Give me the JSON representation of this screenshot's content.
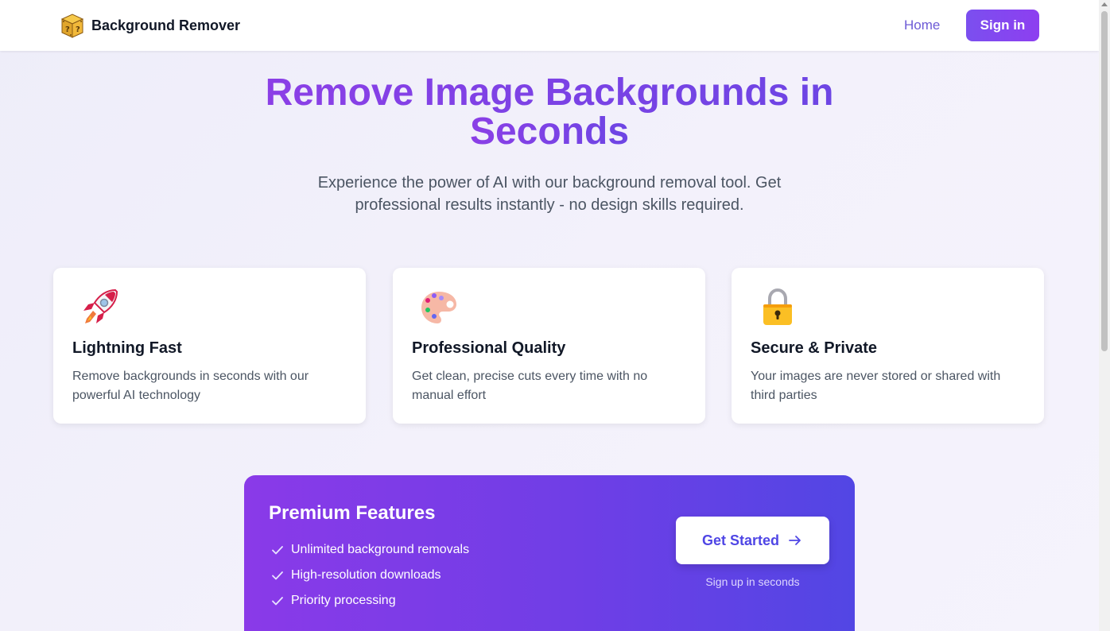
{
  "header": {
    "brand_name": "Background Remover",
    "logo_icon": "mystery-block-icon",
    "nav_home": "Home",
    "nav_signin": "Sign in"
  },
  "hero": {
    "title_line1": "Remove Image Backgrounds in",
    "title_line2": "Seconds",
    "subtitle": "Experience the power of AI with our background removal tool. Get professional results instantly - no design skills required."
  },
  "features": [
    {
      "icon": "rocket-icon",
      "title": "Lightning Fast",
      "text": "Remove backgrounds in seconds with our powerful AI technology"
    },
    {
      "icon": "palette-icon",
      "title": "Professional Quality",
      "text": "Get clean, precise cuts every time with no manual effort"
    },
    {
      "icon": "lock-icon",
      "title": "Secure & Private",
      "text": "Your images are never stored or shared with third parties"
    }
  ],
  "premium": {
    "title": "Premium Features",
    "items": [
      "Unlimited background removals",
      "High-resolution downloads",
      "Priority processing"
    ],
    "cta_label": "Get Started",
    "cta_sub": "Sign up in seconds"
  },
  "colors": {
    "accent": "#7c3aed",
    "indigo": "#4f46e5",
    "text_muted": "#4b5563"
  }
}
